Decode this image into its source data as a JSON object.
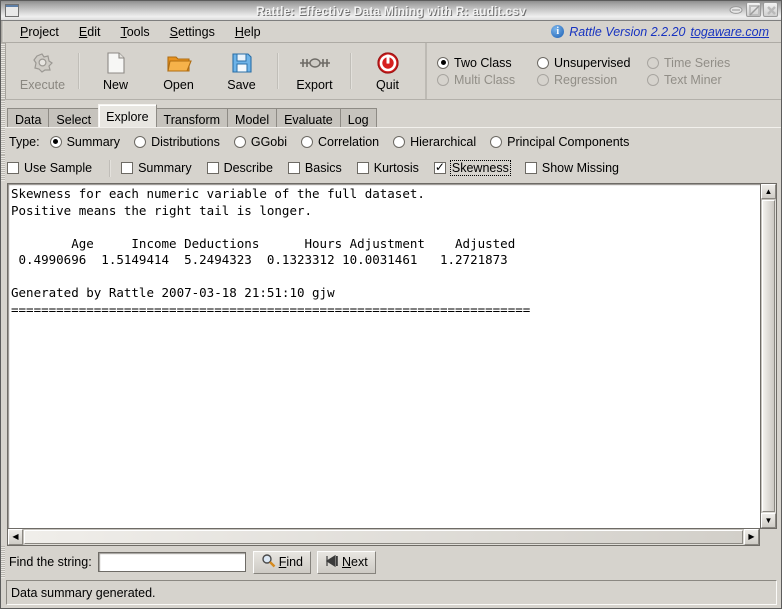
{
  "titlebar": {
    "title": "Rattle: Effective Data Mining with R: audit.csv",
    "menu_icon": "window-menu-icon",
    "buttons": [
      {
        "name": "minimize",
        "icon": "minimize-icon"
      },
      {
        "name": "maximize",
        "icon": "maximize-icon"
      },
      {
        "name": "close",
        "icon": "close-icon"
      }
    ]
  },
  "menubar": {
    "items": [
      {
        "mnemonic": "P",
        "rest": "roject"
      },
      {
        "mnemonic": "E",
        "rest": "dit"
      },
      {
        "mnemonic": "T",
        "rest": "ools"
      },
      {
        "mnemonic": "S",
        "rest": "ettings"
      },
      {
        "mnemonic": "H",
        "rest": "elp"
      }
    ],
    "info_icon": "info-icon",
    "version_text": "Rattle Version 2.2.20",
    "version_link": "togaware.com",
    "link_color": "#1733c0"
  },
  "toolbar": {
    "items": [
      {
        "label": "Execute",
        "icon": "gear-icon",
        "disabled": true
      },
      {
        "label": "New",
        "icon": "new-document-icon",
        "disabled": false
      },
      {
        "label": "Open",
        "icon": "open-folder-icon",
        "disabled": false
      },
      {
        "label": "Save",
        "icon": "floppy-disk-icon",
        "disabled": false
      },
      {
        "label": "Export",
        "icon": "export-connector-icon",
        "disabled": false
      },
      {
        "label": "Quit",
        "icon": "power-off-icon",
        "disabled": false
      }
    ],
    "mode_radios": [
      {
        "label": "Two Class",
        "selected": true,
        "disabled": false
      },
      {
        "label": "Unsupervised",
        "selected": false,
        "disabled": false
      },
      {
        "label": "Time Series",
        "selected": false,
        "disabled": true
      },
      {
        "label": "Multi Class",
        "selected": false,
        "disabled": true
      },
      {
        "label": "Regression",
        "selected": false,
        "disabled": true
      },
      {
        "label": "Text Miner",
        "selected": false,
        "disabled": true
      }
    ]
  },
  "tabs": [
    {
      "label": "Data",
      "active": false
    },
    {
      "label": "Select",
      "active": false
    },
    {
      "label": "Explore",
      "active": true
    },
    {
      "label": "Transform",
      "active": false
    },
    {
      "label": "Model",
      "active": false
    },
    {
      "label": "Evaluate",
      "active": false
    },
    {
      "label": "Log",
      "active": false
    }
  ],
  "type_row": {
    "label": "Type:",
    "options": [
      {
        "label": "Summary",
        "selected": true
      },
      {
        "label": "Distributions",
        "selected": false
      },
      {
        "label": "GGobi",
        "selected": false
      },
      {
        "label": "Correlation",
        "selected": false
      },
      {
        "label": "Hierarchical",
        "selected": false
      },
      {
        "label": "Principal Components",
        "selected": false
      }
    ]
  },
  "checkbox_row": {
    "use_sample": {
      "label": "Use Sample",
      "checked": false
    },
    "options": [
      {
        "label": "Summary",
        "checked": false,
        "focused": false
      },
      {
        "label": "Describe",
        "checked": false,
        "focused": false
      },
      {
        "label": "Basics",
        "checked": false,
        "focused": false
      },
      {
        "label": "Kurtosis",
        "checked": false,
        "focused": false
      },
      {
        "label": "Skewness",
        "checked": true,
        "focused": true
      },
      {
        "label": "Show Missing",
        "checked": false,
        "focused": false
      }
    ]
  },
  "output": {
    "text": "Skewness for each numeric variable of the full dataset.\nPositive means the right tail is longer.\n\n        Age     Income Deductions      Hours Adjustment    Adjusted\n 0.4990696  1.5149414  5.2494323  0.1323312 10.0031461   1.2721873\n\nGenerated by Rattle 2007-03-18 21:51:10 gjw\n=====================================================================",
    "summary_data": {
      "type": "table",
      "title": "Skewness for each numeric variable of the full dataset.",
      "note": "Positive means the right tail is longer.",
      "columns": [
        "Age",
        "Income",
        "Deductions",
        "Hours",
        "Adjustment",
        "Adjusted"
      ],
      "values": [
        0.4990696,
        1.5149414,
        5.2494323,
        0.1323312,
        10.0031461,
        1.2721873
      ],
      "generated_by": "Generated by Rattle 2007-03-18 21:51:10 gjw"
    }
  },
  "scrollbars": {
    "vertical": {
      "up_icon": "triangle-up-icon",
      "down_icon": "triangle-down-icon"
    },
    "horizontal": {
      "left_icon": "triangle-left-icon",
      "right_icon": "triangle-right-icon"
    }
  },
  "findbar": {
    "label": "Find the string:",
    "input_value": "",
    "input_placeholder": "",
    "find_button": {
      "mnemonic": "F",
      "rest": "ind",
      "icon": "magnifier-icon"
    },
    "next_button": {
      "mnemonic": "N",
      "rest": "ext",
      "icon": "skip-next-icon"
    }
  },
  "statusbar": {
    "message": "Data summary generated."
  }
}
